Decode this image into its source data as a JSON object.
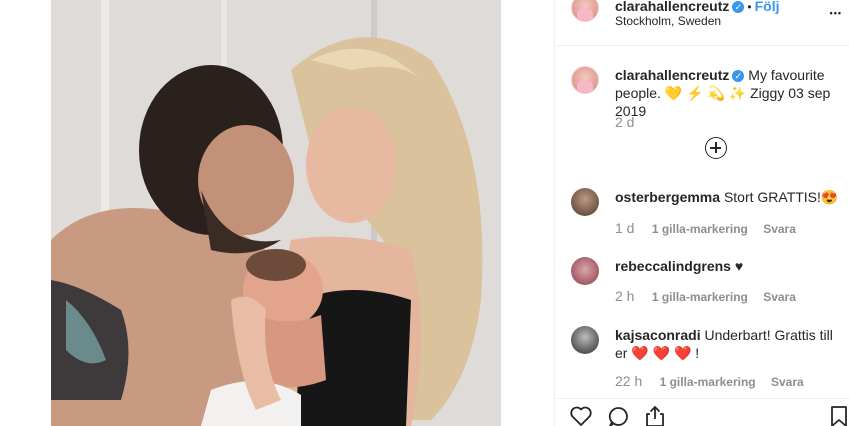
{
  "post": {
    "username": "clarahallencreutz",
    "follow_label": "Följ",
    "location": "Stockholm, Sweden",
    "more_label": "•••",
    "caption_username": "clarahallencreutz",
    "caption_text": "My favourite people. 💛 ⚡ 💫 ✨ Ziggy 03 sep 2019",
    "caption_time": "2 d",
    "photo_description_icon": "family-photo"
  },
  "comments": [
    {
      "username": "osterbergemma",
      "text": "Stort GRATTIS!😍",
      "time": "1 d",
      "likes": "1 gilla-markering",
      "reply": "Svara"
    },
    {
      "username": "rebeccalindgrens",
      "text": "♥",
      "time": "2 h",
      "likes": "1 gilla-markering",
      "reply": "Svara"
    },
    {
      "username": "kajsaconradi",
      "text": "Underbart! Grattis till er ❤️ ❤️ ❤️ !",
      "time": "22 h",
      "likes": "1 gilla-markering",
      "reply": "Svara"
    }
  ],
  "colors": {
    "link": "#3897f0",
    "muted": "#8e8e8e",
    "text": "#262626",
    "border": "#efefef"
  }
}
